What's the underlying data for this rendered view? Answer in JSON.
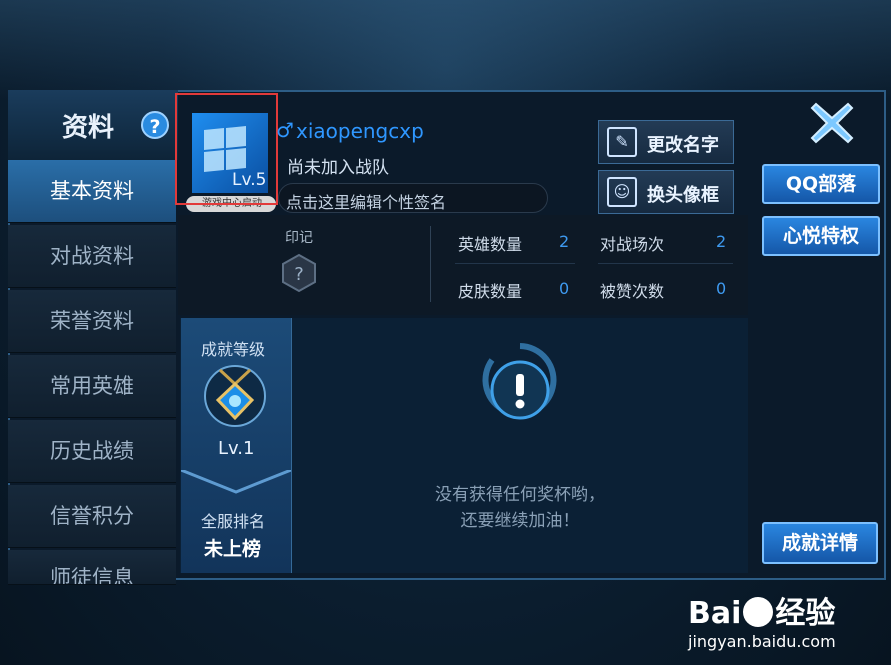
{
  "header": {
    "title": "资料",
    "help_label": "?"
  },
  "nav": {
    "items": [
      {
        "label": "基本资料",
        "active": true
      },
      {
        "label": "对战资料"
      },
      {
        "label": "荣誉资料"
      },
      {
        "label": "常用英雄"
      },
      {
        "label": "历史战绩"
      },
      {
        "label": "信誉积分"
      },
      {
        "label": "师徒信息"
      }
    ]
  },
  "profile": {
    "avatar_level": "Lv.5",
    "avatar_tag": "游戏中心启动",
    "gender_icon": "male-symbol",
    "gender_symbol": "♂",
    "username": "xiaopengcxp",
    "team_status": "尚未加入战队",
    "signature_placeholder": "点击这里编辑个性签名"
  },
  "actions": {
    "rename": "更改名字",
    "change_frame": "换头像框"
  },
  "stats": {
    "mark_label": "印记",
    "items": [
      {
        "label": "英雄数量",
        "value": "2"
      },
      {
        "label": "对战场次",
        "value": "2"
      },
      {
        "label": "皮肤数量",
        "value": "0"
      },
      {
        "label": "被赞次数",
        "value": "0"
      }
    ]
  },
  "achievement": {
    "title": "成就等级",
    "level": "Lv.1",
    "rank_label": "全服排名",
    "rank_value": "未上榜",
    "empty_line1": "没有获得任何奖杯哟，",
    "empty_line2": "还要继续加油！"
  },
  "right": {
    "qq_tribe": "QQ部落",
    "privilege": "心悦特权",
    "details": "成就详情"
  },
  "watermark": {
    "brand": "Bai",
    "brand2": "经验",
    "url": "jingyan.baidu.com"
  },
  "colors": {
    "accent": "#2f97ff",
    "panel": "#0b1a2a",
    "button": "#2a86e0"
  }
}
